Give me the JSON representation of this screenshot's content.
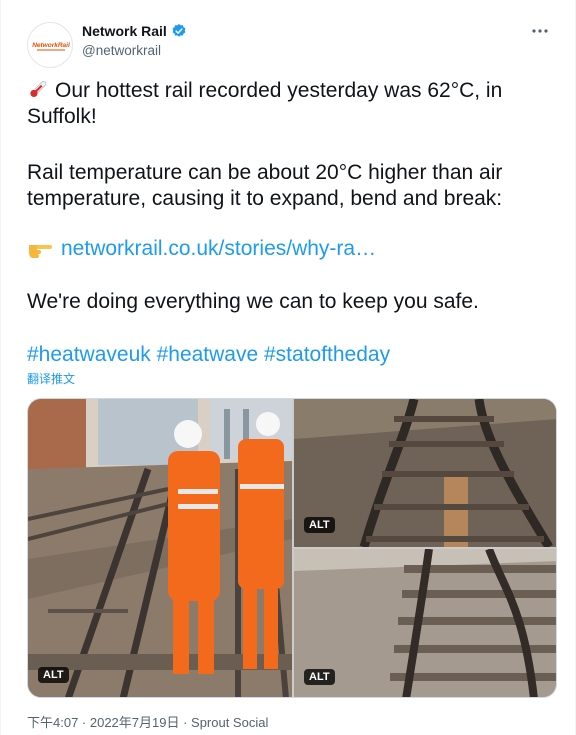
{
  "account": {
    "display_name": "Network Rail",
    "handle": "@networkrail",
    "avatar_text": "NetworkRail",
    "brand_color": "#e05206",
    "verified_color": "#1d9bf0"
  },
  "tweet": {
    "line1": "Our hottest rail recorded yesterday was 62°C, in Suffolk!",
    "line2": "Rail temperature can be about 20°C higher than air temperature, causing it to expand, bend and break:",
    "link": "networkrail.co.uk/stories/why-ra…",
    "line4": "We're doing everything we can to keep you safe.",
    "hashtags": "#heatwaveuk #heatwave #statoftheday",
    "translate_label": "翻译推文"
  },
  "media": {
    "alt_badge": "ALT"
  },
  "meta": {
    "timestamp": "下午4:07 · 2022年7月19日 · Sprout Social"
  },
  "icons": {
    "more": "more-icon",
    "verified": "verified-icon",
    "thermometer": "thermometer-icon",
    "pointer": "pointing-hand-icon"
  }
}
